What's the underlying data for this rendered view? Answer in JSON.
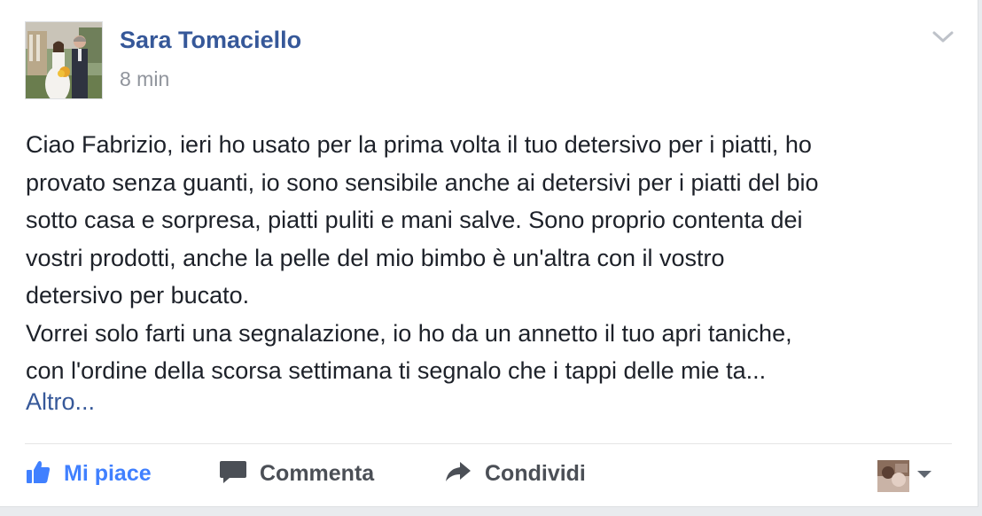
{
  "post": {
    "author": "Sara Tomaciello",
    "timestamp": "8 min",
    "paragraph_lines": [
      "Ciao Fabrizio, ieri ho usato per la prima volta il tuo detersivo per i piatti, ho",
      "provato senza guanti, io sono sensibile anche ai detersivi per i piatti del bio",
      "sotto casa e sorpresa, piatti puliti e mani salve. Sono proprio contenta dei",
      "vostri prodotti, anche la pelle del mio bimbo è un'altra con il vostro",
      "detersivo per bucato.",
      "Vorrei solo farti una segnalazione, io ho da un annetto il tuo apri taniche,",
      "con l'ordine della scorsa settimana ti segnalo che i tappi delle mie ta..."
    ],
    "more_link": "Altro..."
  },
  "actions": {
    "like_label": "Mi piace",
    "comment_label": "Commenta",
    "share_label": "Condividi"
  },
  "icons": {
    "header_menu": "chevron-down-icon",
    "like": "thumbs-up-icon",
    "comment": "speech-bubble-icon",
    "share": "share-arrow-icon",
    "reaction_dropdown": "caret-down-icon"
  },
  "colors": {
    "link_blue": "#365899",
    "like_blue": "#4080ff",
    "text": "#1d2129",
    "muted": "#90949c",
    "action_gray": "#4b4f56"
  }
}
